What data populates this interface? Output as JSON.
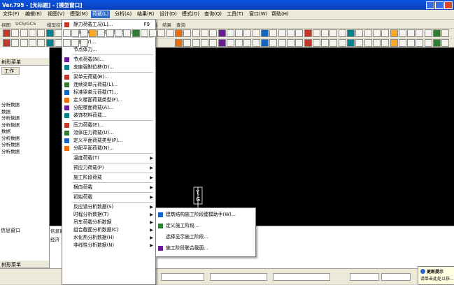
{
  "window": {
    "title": "Ver.795 - [无标题] - [模型窗口]"
  },
  "menubar": {
    "items": [
      "文件(F)",
      "编辑(E)",
      "视图(V)",
      "模型(M)",
      "荷载(L)",
      "分析(A)",
      "结果(R)",
      "设计(D)",
      "模式(O)",
      "查询(Q)",
      "工具(T)",
      "窗口(W)",
      "帮助(H)"
    ],
    "active_index": 4
  },
  "toolbar_tabs": [
    "视图",
    "UCS/GCS",
    "模型控制",
    "组",
    "边界",
    "质量",
    "阶段",
    "荷载",
    "建立",
    "网格",
    "结果",
    "查询"
  ],
  "left_panel": {
    "header": "树形菜单",
    "tab": "工作",
    "tree": [
      "分析数据",
      "数据",
      "分析数据",
      "分析数据",
      "数据",
      "分析数据",
      "分析数据",
      "分析数据"
    ],
    "footer": "树形菜单"
  },
  "bottom_panel": {
    "header": "信息窗口",
    "row": "经济"
  },
  "canvas": {
    "axis_labels": [
      "Y",
      "G"
    ]
  },
  "colors": {
    "accent": "#316ac5",
    "titlebar": "#0840b8",
    "canvas": "#000000"
  },
  "dropdown": {
    "items": [
      {
        "label": "静力荷载工况(L)...",
        "shortcut": "F9",
        "icon": "load-case-icon",
        "sep_before": false,
        "arrow": false
      },
      {
        "label": "由荷载组合建立荷载工况(C)...",
        "shortcut": "",
        "icon": "",
        "sep_before": false,
        "arrow": false
      },
      {
        "label": "自重(W)...",
        "shortcut": "",
        "icon": "self-weight-icon",
        "sep_before": true,
        "arrow": false
      },
      {
        "label": "节点体力...",
        "shortcut": "",
        "icon": "",
        "sep_before": false,
        "arrow": false
      },
      {
        "label": "节点荷载(N)...",
        "shortcut": "",
        "icon": "node-load-icon",
        "sep_before": true,
        "arrow": false
      },
      {
        "label": "支座强制位移(D)...",
        "shortcut": "",
        "icon": "support-displacement-icon",
        "sep_before": false,
        "arrow": false
      },
      {
        "label": "梁单元荷载(B)...",
        "shortcut": "",
        "icon": "beam-load-icon",
        "sep_before": true,
        "arrow": false
      },
      {
        "label": "连续梁单元荷载(L)...",
        "shortcut": "",
        "icon": "continuous-beam-load-icon",
        "sep_before": false,
        "arrow": false
      },
      {
        "label": "标准梁单元荷载(T)...",
        "shortcut": "",
        "icon": "standard-beam-load-icon",
        "sep_before": false,
        "arrow": false
      },
      {
        "label": "定义楼面荷载类型(F)...",
        "shortcut": "",
        "icon": "floor-load-type-icon",
        "sep_before": false,
        "arrow": false
      },
      {
        "label": "分配楼面荷载(A)...",
        "shortcut": "",
        "icon": "assign-floor-load-icon",
        "sep_before": false,
        "arrow": false
      },
      {
        "label": "装饰材料荷载...",
        "shortcut": "",
        "icon": "finish-load-icon",
        "sep_before": false,
        "arrow": false
      },
      {
        "label": "压力荷载(E)...",
        "shortcut": "",
        "icon": "pressure-load-icon",
        "sep_before": true,
        "arrow": false
      },
      {
        "label": "流体压力荷载(U)...",
        "shortcut": "",
        "icon": "hydrostatic-load-icon",
        "sep_before": false,
        "arrow": false
      },
      {
        "label": "定义平面荷载类型(P)...",
        "shortcut": "",
        "icon": "plane-load-type-icon",
        "sep_before": false,
        "arrow": false
      },
      {
        "label": "分配平面荷载(N)...",
        "shortcut": "",
        "icon": "assign-plane-load-icon",
        "sep_before": false,
        "arrow": false
      },
      {
        "label": "温度荷载(T)",
        "shortcut": "",
        "icon": "",
        "sep_before": true,
        "arrow": true
      },
      {
        "label": "预应力荷载(P)",
        "shortcut": "",
        "icon": "",
        "sep_before": true,
        "arrow": true
      },
      {
        "label": "施工阶段荷载",
        "shortcut": "",
        "icon": "",
        "sep_before": true,
        "arrow": true
      },
      {
        "label": "横向荷载",
        "shortcut": "",
        "icon": "",
        "sep_before": true,
        "arrow": true
      },
      {
        "label": "初始荷载",
        "shortcut": "",
        "icon": "",
        "sep_before": true,
        "arrow": true
      },
      {
        "label": "反应谱分析数据(S)",
        "shortcut": "",
        "icon": "",
        "sep_before": true,
        "arrow": true
      },
      {
        "label": "时程分析数据(T)",
        "shortcut": "",
        "icon": "",
        "sep_before": false,
        "arrow": true
      },
      {
        "label": "吊车荷载分析数据",
        "shortcut": "",
        "icon": "",
        "sep_before": false,
        "arrow": true
      },
      {
        "label": "组合截面分析数据(C)",
        "shortcut": "",
        "icon": "",
        "sep_before": false,
        "arrow": true
      },
      {
        "label": "水化热分析数据(H)",
        "shortcut": "",
        "icon": "",
        "sep_before": false,
        "arrow": true
      },
      {
        "label": "非线性分析数据(N)",
        "shortcut": "",
        "icon": "",
        "sep_before": false,
        "arrow": true
      }
    ]
  },
  "submenu": {
    "items": [
      {
        "label": "建筑结构施工阶段建模助手(W)...",
        "icon": "construction-wizard-icon"
      },
      {
        "label": "定义施工阶段...",
        "icon": "define-stage-icon"
      },
      {
        "label": "选择显示施工阶段...",
        "icon": ""
      },
      {
        "label": "施工阶段联合截面...",
        "icon": "composite-section-icon"
      }
    ]
  },
  "notification": {
    "title": "更新提示",
    "text": "请单击此处以获..."
  }
}
